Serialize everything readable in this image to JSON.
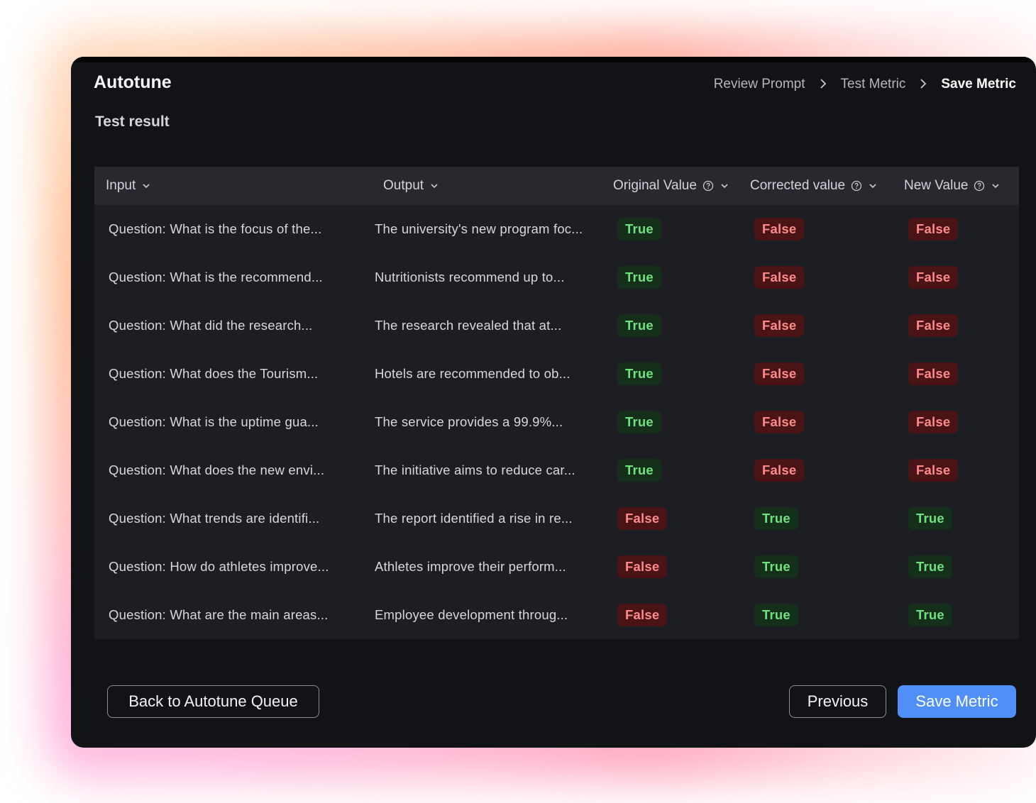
{
  "app": {
    "title": "Autotune"
  },
  "breadcrumb": [
    {
      "label": "Review Prompt",
      "active": false
    },
    {
      "label": "Test Metric",
      "active": false
    },
    {
      "label": "Save Metric",
      "active": true
    }
  ],
  "section_title": "Test result",
  "table": {
    "columns": [
      {
        "label": "Input",
        "help": false
      },
      {
        "label": "Output",
        "help": false
      },
      {
        "label": "Original Value",
        "help": true
      },
      {
        "label": "Corrected value",
        "help": true
      },
      {
        "label": "New Value",
        "help": true
      }
    ],
    "rows": [
      {
        "input": "Question: What is the focus of the...",
        "output": "The university's new program foc...",
        "original": "True",
        "corrected": "False",
        "new": "False"
      },
      {
        "input": "Question: What is the recommend...",
        "output": "Nutritionists recommend up to...",
        "original": "True",
        "corrected": "False",
        "new": "False"
      },
      {
        "input": "Question: What did the research...",
        "output": "The research revealed that at...",
        "original": "True",
        "corrected": "False",
        "new": "False"
      },
      {
        "input": "Question: What does the Tourism...",
        "output": "Hotels are recommended to ob...",
        "original": "True",
        "corrected": "False",
        "new": "False"
      },
      {
        "input": "Question: What is the uptime gua...",
        "output": "The service provides a 99.9%...",
        "original": "True",
        "corrected": "False",
        "new": "False"
      },
      {
        "input": "Question: What does the new envi...",
        "output": "The initiative aims to reduce car...",
        "original": "True",
        "corrected": "False",
        "new": "False"
      },
      {
        "input": "Question: What trends are identifi...",
        "output": "The report identified a rise in re...",
        "original": "False",
        "corrected": "True",
        "new": "True"
      },
      {
        "input": "Question: How do athletes improve...",
        "output": "Athletes improve their perform...",
        "original": "False",
        "corrected": "True",
        "new": "True"
      },
      {
        "input": "Question: What are the main areas...",
        "output": "Employee development throug...",
        "original": "False",
        "corrected": "True",
        "new": "True"
      }
    ]
  },
  "buttons": {
    "back": "Back to Autotune Queue",
    "previous": "Previous",
    "save": "Save Metric"
  },
  "colors": {
    "window_bg": "#121317",
    "table_bg": "#1d1e23",
    "header_bg": "#27292f",
    "true_bg": "#14301b",
    "true_text": "#6fe07f",
    "false_bg": "#4a1417",
    "false_text": "#ff8a8a",
    "primary": "#4f8ff7"
  },
  "icons": {
    "column_sort": "chevron-down-icon",
    "column_help": "help-circle-icon",
    "breadcrumb_separator": "chevron-right-icon"
  }
}
